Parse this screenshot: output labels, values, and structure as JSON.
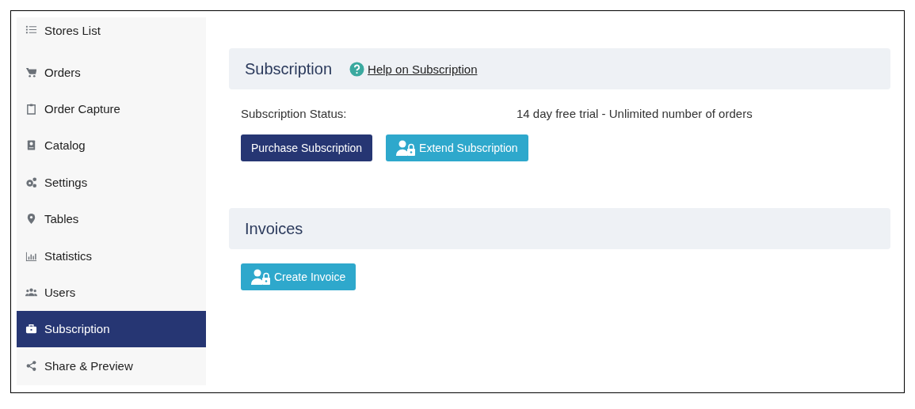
{
  "sidebar": {
    "items": [
      {
        "label": "Stores List",
        "selected": false
      },
      {
        "label": "Orders",
        "selected": false
      },
      {
        "label": "Order Capture",
        "selected": false
      },
      {
        "label": "Catalog",
        "selected": false
      },
      {
        "label": "Settings",
        "selected": false
      },
      {
        "label": "Tables",
        "selected": false
      },
      {
        "label": "Statistics",
        "selected": false
      },
      {
        "label": "Users",
        "selected": false
      },
      {
        "label": "Subscription",
        "selected": true
      },
      {
        "label": "Share & Preview",
        "selected": false
      }
    ]
  },
  "subscription": {
    "title": "Subscription",
    "help_link": "Help on Subscription",
    "status_label": "Subscription Status:",
    "status_value": "14 day free trial - Unlimited number of orders",
    "buttons": [
      {
        "label": "Purchase Subscription",
        "kind": "primary"
      },
      {
        "label": "Extend Subscription",
        "kind": "info"
      }
    ]
  },
  "invoices": {
    "title": "Invoices",
    "buttons": [
      {
        "label": "Create Invoice",
        "kind": "info"
      }
    ]
  }
}
